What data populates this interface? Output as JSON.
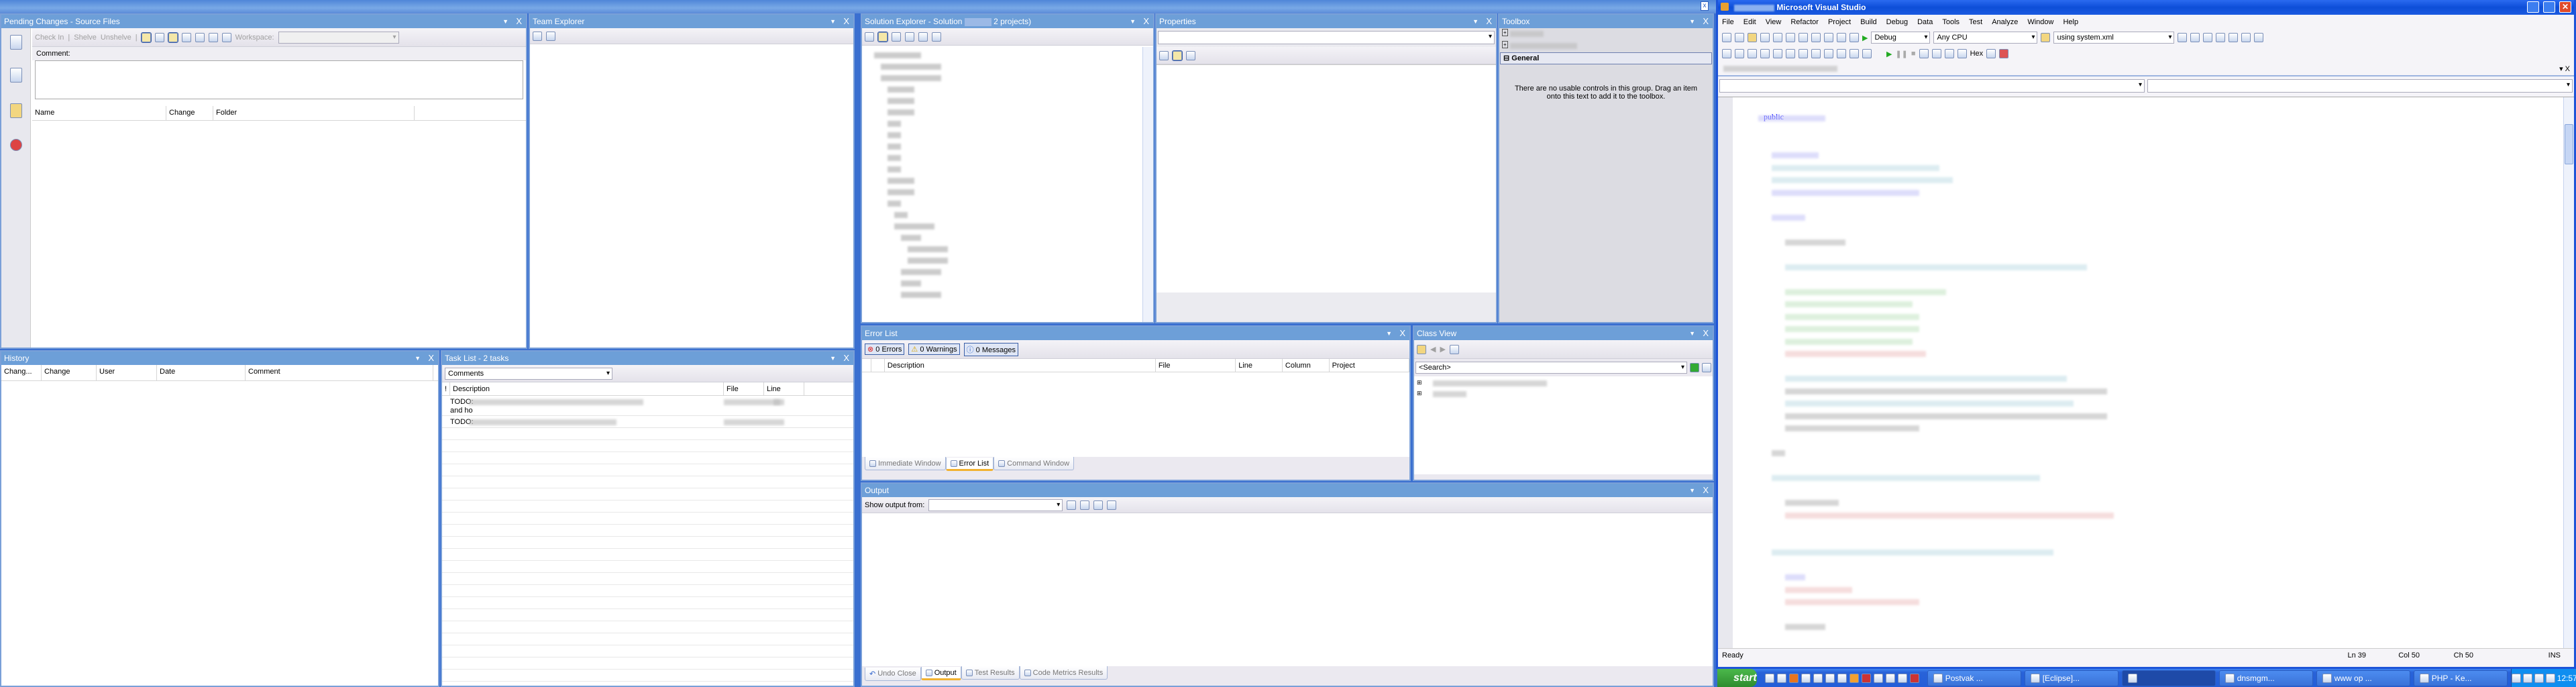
{
  "pending": {
    "title": "Pending Changes - Source Files",
    "check_in": "Check In",
    "shelve": "Shelve",
    "unshelve": "Unshelve",
    "workspace": "Workspace:",
    "comment": "Comment:",
    "cols": [
      "Name",
      "Change",
      "Folder"
    ]
  },
  "team_explorer": {
    "title": "Team Explorer"
  },
  "history": {
    "title": "History",
    "cols": [
      "Chang...",
      "Change",
      "User",
      "Date",
      "Comment"
    ]
  },
  "task_list": {
    "title": "Task List - 2 tasks",
    "filter": "Comments",
    "cols": [
      "!",
      "Description",
      "File",
      "Line"
    ],
    "rows": [
      {
        "prefix": "TODO:",
        "extra": "and ho"
      },
      {
        "prefix": "TODO:"
      }
    ]
  },
  "solution_explorer": {
    "title": "Solution Explorer - Solution",
    "title_suffix": "2 projects)"
  },
  "properties": {
    "title": "Properties"
  },
  "toolbox": {
    "title": "Toolbox",
    "group": "General",
    "empty_msg": "There are no usable controls in this group. Drag an item onto this text to add it to the toolbox."
  },
  "error_list": {
    "title": "Error List",
    "errors": "0 Errors",
    "warnings": "0 Warnings",
    "messages": "0 Messages",
    "cols": [
      "Description",
      "File",
      "Line",
      "Column",
      "Project"
    ],
    "tabs": [
      "Immediate Window",
      "Error List",
      "Command Window"
    ]
  },
  "class_view": {
    "title": "Class View",
    "search": "<Search>"
  },
  "output": {
    "title": "Output",
    "show_from": "Show output from:",
    "tabs": [
      "Undo Close",
      "Output",
      "Test Results",
      "Code Metrics Results"
    ]
  },
  "vs": {
    "title": "Microsoft Visual Studio",
    "menu": [
      "File",
      "Edit",
      "View",
      "Refactor",
      "Project",
      "Build",
      "Debug",
      "Data",
      "Tools",
      "Test",
      "Analyze",
      "Window",
      "Help"
    ],
    "config": "Debug",
    "platform": "Any CPU",
    "find": "using system.xml",
    "hex": "Hex",
    "code_keyword": "public",
    "status": {
      "ready": "Ready",
      "ln": "Ln 39",
      "col": "Col 50",
      "ch": "Ch 50",
      "ins": "INS"
    }
  },
  "taskbar": {
    "start": "start",
    "tasks": [
      "Postvak ...",
      "[Eclipse]...",
      "",
      "dnsmgm...",
      "www op ...",
      "PHP - Ke..."
    ],
    "clock": "12:57"
  },
  "colors": {
    "caption": "#6d9fd8",
    "taskbar": "#3a72d8",
    "start": "#3c9a3c"
  }
}
